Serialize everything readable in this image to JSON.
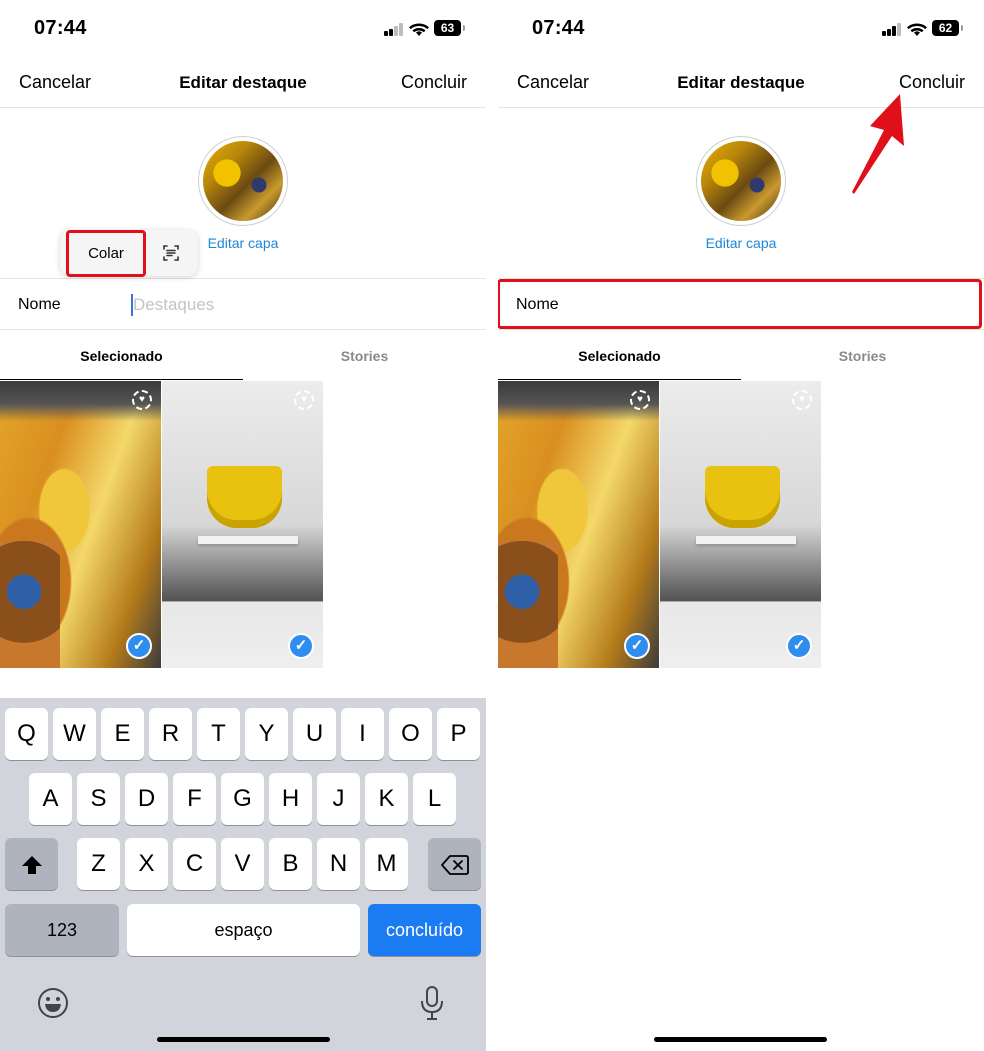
{
  "screens": [
    {
      "status": {
        "time": "07:44",
        "battery": "63"
      },
      "header": {
        "cancel": "Cancelar",
        "title": "Editar destaque",
        "done": "Concluir"
      },
      "cover": {
        "edit_label": "Editar capa"
      },
      "name_row": {
        "label": "Nome",
        "placeholder": "Destaques"
      },
      "paste_menu": {
        "paste": "Colar",
        "scan_icon": "scan-text-icon"
      },
      "tabs": [
        "Selecionado",
        "Stories"
      ],
      "keyboard": {
        "row1": [
          "Q",
          "W",
          "E",
          "R",
          "T",
          "Y",
          "U",
          "I",
          "O",
          "P"
        ],
        "row2": [
          "A",
          "S",
          "D",
          "F",
          "G",
          "H",
          "J",
          "K",
          "L"
        ],
        "row3": [
          "Z",
          "X",
          "C",
          "V",
          "B",
          "N",
          "M"
        ],
        "shift_icon": "shift-icon",
        "delete_icon": "backspace-icon",
        "numbers": "123",
        "space": "espaço",
        "return": "concluído",
        "emoji_icon": "emoji-icon",
        "mic_icon": "microphone-icon"
      }
    },
    {
      "status": {
        "time": "07:44",
        "battery": "62"
      },
      "header": {
        "cancel": "Cancelar",
        "title": "Editar destaque",
        "done": "Concluir"
      },
      "cover": {
        "edit_label": "Editar capa"
      },
      "name_row": {
        "value": "Nome"
      },
      "tabs": [
        "Selecionado",
        "Stories"
      ]
    }
  ],
  "colors": {
    "highlight_red": "#e0101b",
    "link_blue": "#1a86d8",
    "check_blue": "#2f8df0",
    "key_blue": "#1a7bf2"
  }
}
